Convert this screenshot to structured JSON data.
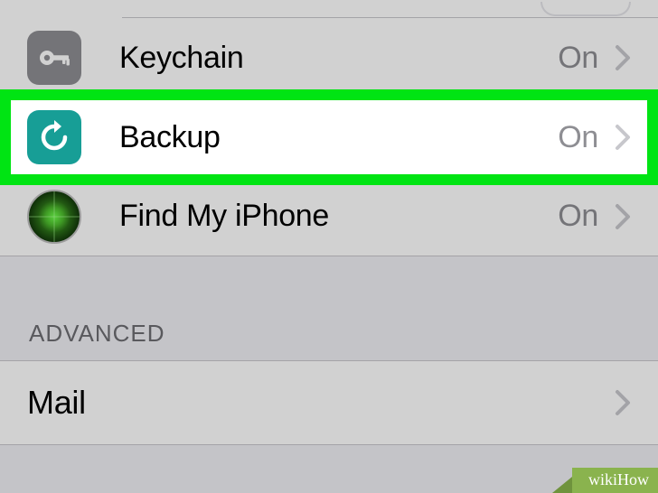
{
  "rows": {
    "keychain": {
      "label": "Keychain",
      "status": "On",
      "icon_name": "key-icon"
    },
    "backup": {
      "label": "Backup",
      "status": "On",
      "icon_name": "backup-restore-icon"
    },
    "findmy": {
      "label": "Find My iPhone",
      "status": "On",
      "icon_name": "radar-icon"
    },
    "mail": {
      "label": "Mail"
    }
  },
  "section_header": "ADVANCED",
  "watermark": "wikiHow",
  "colors": {
    "highlight_border": "#00e413",
    "row_bg": "#ffffff",
    "screen_bg": "#efeff4",
    "status_text": "#8e8e93",
    "keychain_icon_bg": "#8e8e93",
    "backup_icon_bg": "#179e96"
  }
}
